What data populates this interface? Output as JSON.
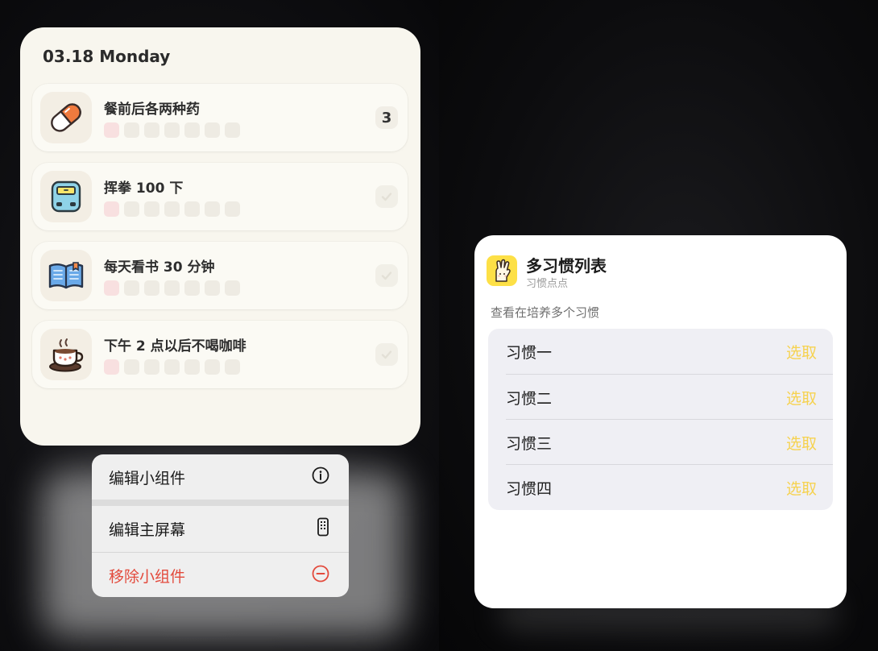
{
  "habit_widget": {
    "date": "03.18 Monday",
    "habits": [
      {
        "name": "餐前后各两种药",
        "icon": "pill-capsule-icon",
        "count": "3",
        "progress_done": 1,
        "progress_total": 7
      },
      {
        "name": "挥拳 100 下",
        "icon": "bathroom-scale-icon",
        "count": "",
        "progress_done": 1,
        "progress_total": 7
      },
      {
        "name": "每天看书 30 分钟",
        "icon": "open-book-icon",
        "count": "",
        "progress_done": 1,
        "progress_total": 7
      },
      {
        "name": "下午 2 点以后不喝咖啡",
        "icon": "coffee-cup-icon",
        "count": "",
        "progress_done": 1,
        "progress_total": 7
      }
    ]
  },
  "context_menu": {
    "items": [
      {
        "label": "编辑小组件",
        "icon": "info-circle-icon"
      },
      {
        "label": "编辑主屏幕",
        "icon": "phone-device-icon"
      },
      {
        "label": "移除小组件",
        "icon": "minus-circle-icon"
      }
    ]
  },
  "shortcut_widget": {
    "title": "多习惯列表",
    "subtitle": "习惯点点",
    "app_icon": "raised-hand-icon",
    "section_label": "查看在培养多个习惯",
    "rows": [
      {
        "label": "习惯一",
        "action": "选取"
      },
      {
        "label": "习惯二",
        "action": "选取"
      },
      {
        "label": "习惯三",
        "action": "选取"
      },
      {
        "label": "习惯四",
        "action": "选取"
      }
    ]
  },
  "colors": {
    "accent_yellow": "#f6d24f",
    "danger_red": "#e34a3c",
    "widget_cream": "#f8f6ee",
    "progress_done": "#f8e0e0"
  }
}
